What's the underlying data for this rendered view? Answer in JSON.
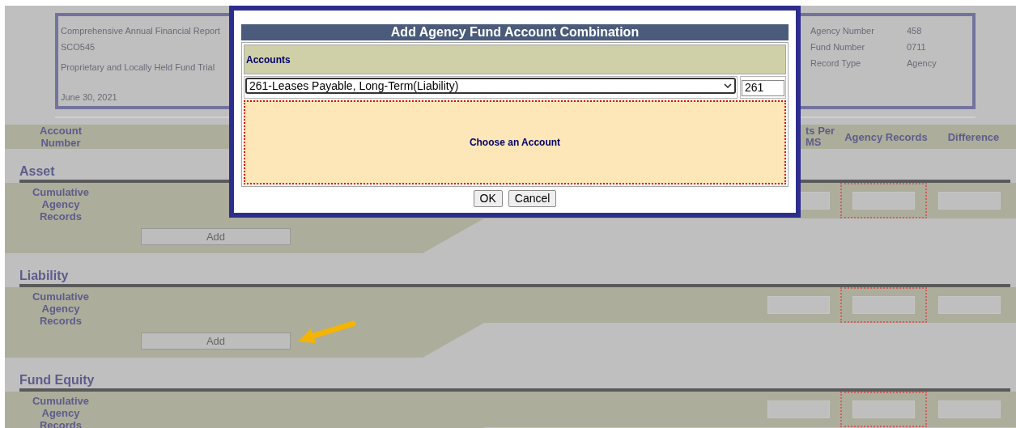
{
  "report_header": {
    "lines": [
      "Comprehensive Annual Financial Report",
      "SCO545",
      "Proprietary and Locally Held Fund Trial",
      "June 30, 2021"
    ],
    "fields": [
      {
        "label": "Agency Number",
        "value": "458"
      },
      {
        "label": "Fund Number",
        "value": "0711"
      },
      {
        "label": "Record Type",
        "value": "Agency"
      }
    ]
  },
  "columns": [
    {
      "label": "Account Number"
    },
    {
      "label": "ts Per MS"
    },
    {
      "label": "Agency Records"
    },
    {
      "label": "Difference"
    }
  ],
  "sections": [
    {
      "title": "Asset",
      "row_label": "Cumulative Agency Records",
      "add_button": "Add"
    },
    {
      "title": "Liability",
      "row_label": "Cumulative Agency Records",
      "add_button": "Add"
    },
    {
      "title": "Fund Equity",
      "row_label": "Cumulative Agency Records"
    }
  ],
  "dialog": {
    "title": "Add Agency Fund Account Combination",
    "accounts_label": "Accounts",
    "account_select": "261-Leases Payable, Long-Term(Liability)",
    "account_code": "261",
    "message": "Choose an Account",
    "buttons": [
      "OK",
      "Cancel"
    ]
  }
}
